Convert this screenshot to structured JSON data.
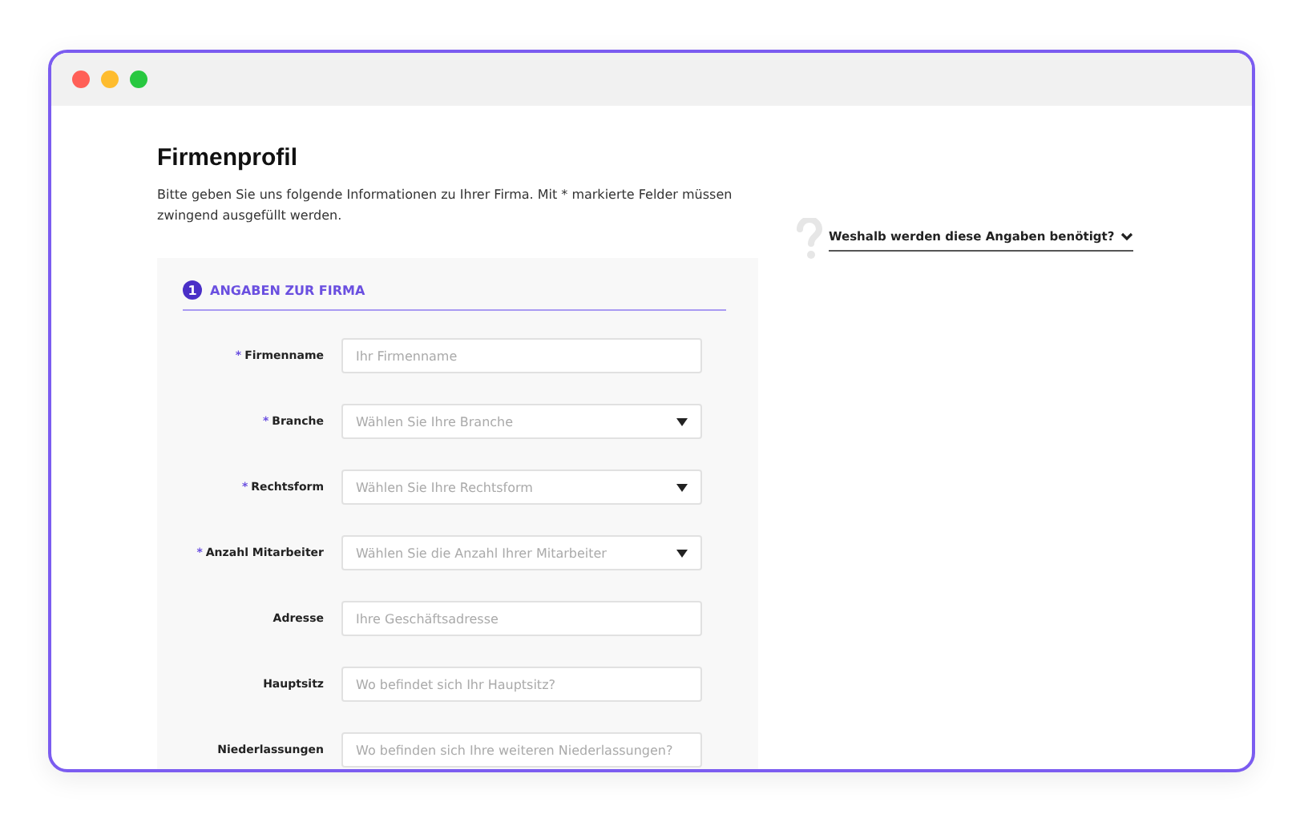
{
  "page": {
    "title": "Firmenprofil",
    "intro": "Bitte geben Sie uns folgende Informationen zu Ihrer Firma. Mit * markierte Felder müssen zwingend ausgefüllt werden."
  },
  "section": {
    "number": "1",
    "title": "ANGABEN ZUR FIRMA"
  },
  "fields": [
    {
      "label": "Firmenname",
      "required_mark": "*",
      "kind": "text",
      "placeholder": "Ihr Firmenname"
    },
    {
      "label": "Branche",
      "required_mark": "*",
      "kind": "select",
      "placeholder": "Wählen Sie Ihre Branche"
    },
    {
      "label": "Rechtsform",
      "required_mark": "*",
      "kind": "select",
      "placeholder": "Wählen Sie Ihre Rechtsform"
    },
    {
      "label": "Anzahl Mitarbeiter",
      "required_mark": "*",
      "kind": "select",
      "placeholder": "Wählen Sie die Anzahl Ihrer Mitarbeiter"
    },
    {
      "label": "Adresse",
      "kind": "text",
      "placeholder": "Ihre Geschäftsadresse"
    },
    {
      "label": "Hauptsitz",
      "kind": "text",
      "placeholder": "Wo befindet sich Ihr Hauptsitz?"
    },
    {
      "label": "Niederlassungen",
      "kind": "text",
      "placeholder": "Wo befinden sich Ihre weiteren Niederlassungen?"
    }
  ],
  "help": {
    "question": "Weshalb werden diese Angaben benötigt?",
    "expanded": false
  }
}
